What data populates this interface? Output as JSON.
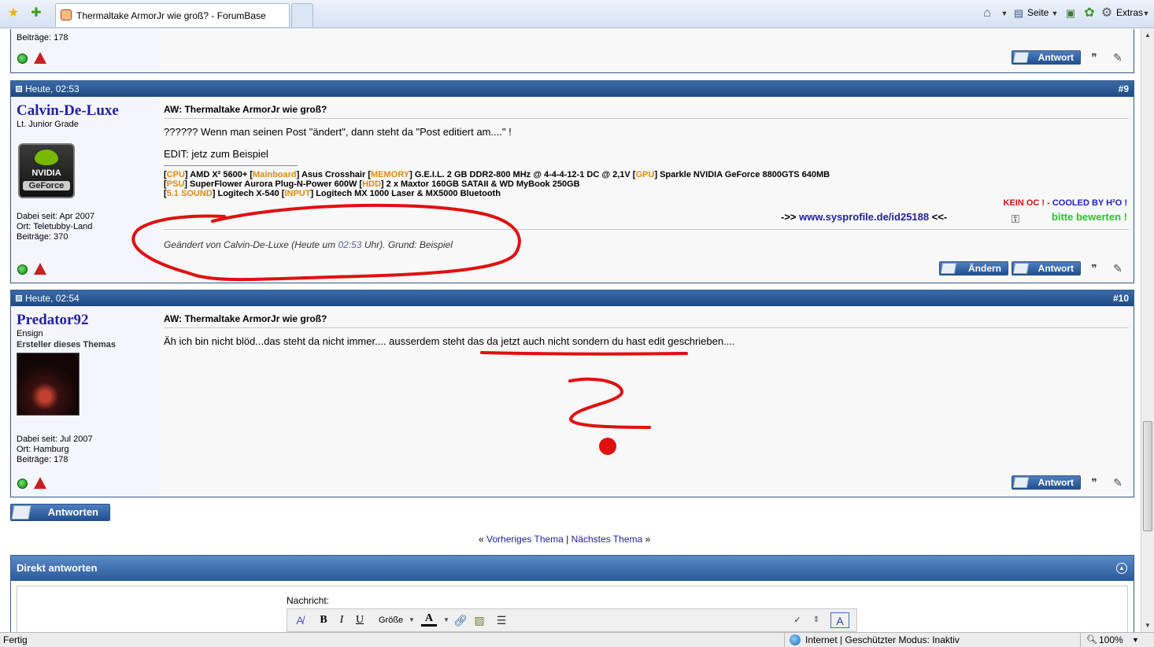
{
  "browser": {
    "tab_title": "Thermaltake ArmorJr wie groß? - ForumBase",
    "cmd_page": "Seite",
    "cmd_extras": "Extras",
    "status_left": "Fertig",
    "status_zone": "Internet | Geschützter Modus: Inaktiv",
    "zoom": "100%"
  },
  "prev_post": {
    "posts": "Beiträge: 178",
    "reply_label": "Antwort"
  },
  "posts": [
    {
      "date": "Heute, 02:53",
      "num": "#9",
      "username": "Calvin-De-Luxe",
      "rank": "Lt. Junior Grade",
      "avatar_brand": "NVIDIA",
      "avatar_product": "GeForce",
      "joined": "Dabei seit: Apr 2007",
      "location": "Ort: Teletubby-Land",
      "posts": "Beiträge: 370",
      "title": "AW: Thermaltake ArmorJr wie groß?",
      "line1": "?????? Wenn man seinen Post \"ändert\", dann steht da \"Post editiert am....\" !",
      "line2": "EDIT: jetz zum Beispiel",
      "sig": {
        "cpu_k": "CPU",
        "cpu": "AMD X² 5600+",
        "mb_k": "Mainboard",
        "mb": "Asus Crosshair",
        "mem_k": "MEMORY",
        "mem": "G.E.I.L. 2 GB DDR2-800 MHz @ 4-4-4-12-1 DC @ 2,1V",
        "gpu_k": "GPU",
        "gpu": "Sparkle NVIDIA GeForce 8800GTS 640MB",
        "psu_k": "PSU",
        "psu": "SuperFlower Aurora Plug-N-Power 600W",
        "hdd_k": "HDD",
        "hdd": "2 x Maxtor 160GB SATAII & WD MyBook 250GB",
        "snd_k": "5.1 SOUND",
        "snd": "Logitech X-540",
        "inp_k": "INPUT",
        "inp": "Logitech MX 1000 Laser & MX5000 Bluetooth",
        "oc_red": "KEIN OC ! -",
        "oc_blue": "COOLED BY H²O !",
        "arrow_left": "->>",
        "link": "www.sysprofile.de/id25188",
        "arrow_right": "<<-",
        "rate": "bitte bewerten !"
      },
      "edit_prefix": "Geändert von Calvin-De-Luxe (Heute um",
      "edit_time": "02:53",
      "edit_suffix": "Uhr). Grund: Beispiel",
      "edit_label": "Ändern",
      "reply_label": "Antwort"
    },
    {
      "date": "Heute, 02:54",
      "num": "#10",
      "username": "Predator92",
      "rank": "Ensign",
      "creator": "Ersteller dieses Themas",
      "joined": "Dabei seit: Jul 2007",
      "location": "Ort: Hamburg",
      "posts": "Beiträge: 178",
      "title": "AW: Thermaltake ArmorJr wie groß?",
      "line1": "Äh ich bin nicht blöd...das steht da nicht immer.... ausserdem steht das da jetzt auch nicht sondern du hast edit geschrieben....",
      "reply_label": "Antwort"
    }
  ],
  "reply_button": "Antworten",
  "nav": {
    "prev": "Vorheriges Thema",
    "sep": "|",
    "next": "Nächstes Thema"
  },
  "quick_reply": {
    "title": "Direkt antworten",
    "message_label": "Nachricht:",
    "size_label": "Größe"
  }
}
